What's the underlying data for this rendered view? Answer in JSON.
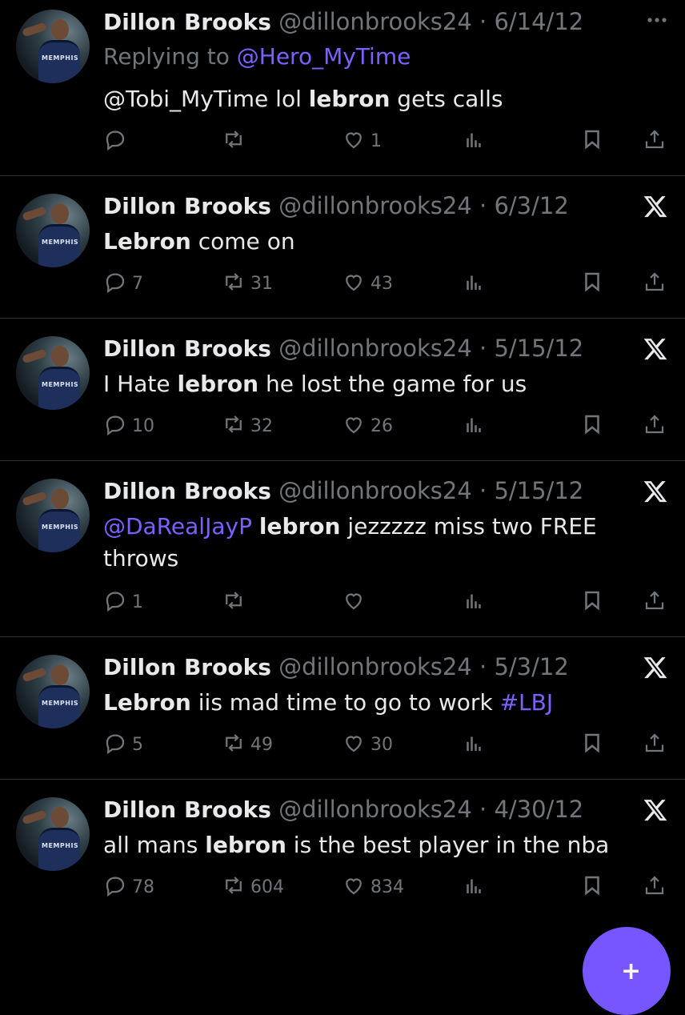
{
  "tweets": [
    {
      "name": "Dillon Brooks",
      "handle": "@dillonbrooks24",
      "sep": "·",
      "date": "6/14/12",
      "replying_prefix": "Replying to ",
      "replying_to": "@Hero_MyTime",
      "text_parts": [
        "@Tobi_MyTime lol ",
        "lebron",
        " gets calls"
      ],
      "corner": "more",
      "replies": "",
      "retweets": "",
      "likes": "1"
    },
    {
      "name": "Dillon Brooks",
      "handle": "@dillonbrooks24",
      "sep": "·",
      "date": "6/3/12",
      "text_parts": [
        "Lebron",
        " come on"
      ],
      "corner": "x",
      "replies": "7",
      "retweets": "31",
      "likes": "43"
    },
    {
      "name": "Dillon Brooks",
      "handle": "@dillonbrooks24",
      "sep": "·",
      "date": "5/15/12",
      "text_parts": [
        "I Hate ",
        "lebron",
        " he lost the game for us"
      ],
      "corner": "x",
      "replies": "10",
      "retweets": "32",
      "likes": "26"
    },
    {
      "name": "Dillon Brooks",
      "handle": "@dillonbrooks24",
      "sep": "·",
      "date": "5/15/12",
      "text_parts": [
        "@DaRealJayP",
        " ",
        "lebron",
        " jezzzzz miss two FREE throws"
      ],
      "corner": "x",
      "replies": "1",
      "retweets": "",
      "likes": ""
    },
    {
      "name": "Dillon Brooks",
      "handle": "@dillonbrooks24",
      "sep": "·",
      "date": "5/3/12",
      "text_parts": [
        "Lebron",
        " iis mad time to go to work ",
        "#LBJ"
      ],
      "corner": "x",
      "replies": "5",
      "retweets": "49",
      "likes": "30"
    },
    {
      "name": "Dillon Brooks",
      "handle": "@dillonbrooks24",
      "sep": "·",
      "date": "4/30/12",
      "text_parts": [
        "all mans ",
        "lebron",
        " is the best player in the nba"
      ],
      "corner": "x",
      "replies": "78",
      "retweets": "604",
      "likes": "834"
    }
  ],
  "avatar_jersey_text": "MEMPHIS",
  "fab": {
    "label": "+"
  },
  "colors": {
    "background": "#000000",
    "text": "#e7e9ea",
    "muted": "#71767b",
    "accent": "#7b61ff",
    "fab": "#7856ff"
  }
}
